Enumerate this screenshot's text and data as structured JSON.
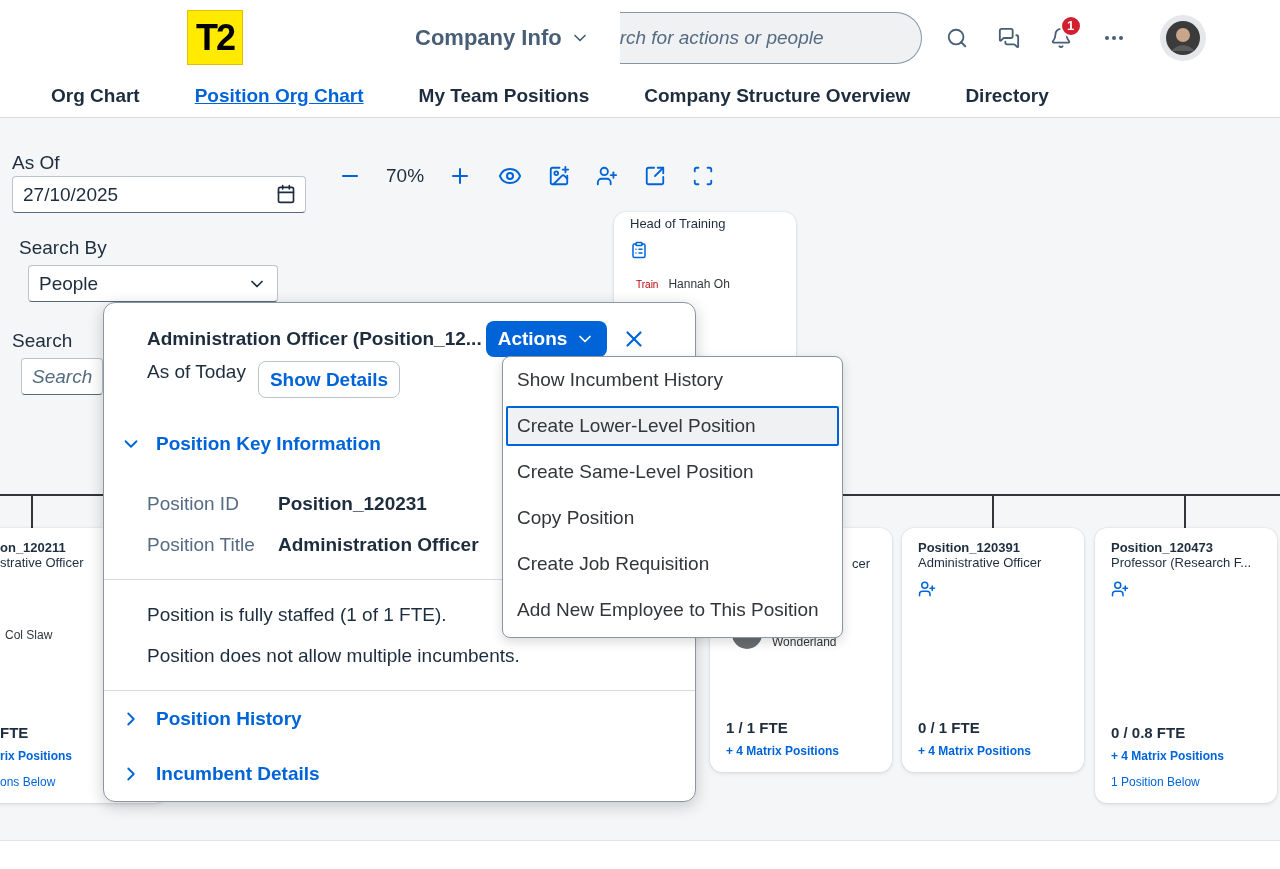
{
  "header": {
    "logo": "T2",
    "app_menu": {
      "label": "Company Info",
      "expanded": false
    },
    "search": {
      "placeholder": "rch for actions or people"
    },
    "notifications": {
      "count": "1"
    }
  },
  "nav_tabs": [
    {
      "label": "Org Chart",
      "selected": false
    },
    {
      "label": "Position Org Chart",
      "selected": true
    },
    {
      "label": "My Team Positions",
      "selected": false
    },
    {
      "label": "Company Structure Overview",
      "selected": false
    },
    {
      "label": "Directory",
      "selected": false
    }
  ],
  "filters": {
    "as_of": {
      "label": "As Of",
      "value": "27/10/2025"
    },
    "search_by": {
      "label": "Search By",
      "value": "People"
    },
    "search": {
      "label": "Search",
      "placeholder": "Search"
    }
  },
  "zoom": {
    "reading": "70%"
  },
  "chart_nodes": [
    {
      "kind": "requisition",
      "title": "Head of Training",
      "tag": "Train",
      "incumbent": "Hannah Oh"
    },
    {
      "kind": "partial",
      "id": "on_120211",
      "title": "strative Officer",
      "incumbent": "Col Slaw",
      "fte": "FTE",
      "matrix": "rix Positions",
      "below": "ons Below"
    },
    {
      "kind": "filled",
      "title": "cer",
      "incumbent": "Wonderland",
      "fte": "1 / 1 FTE",
      "matrix": "+ 4 Matrix Positions"
    },
    {
      "kind": "vacant",
      "id": "Position_120391",
      "title": "Administrative Officer",
      "fte": "0 / 1 FTE",
      "matrix": "+ 4 Matrix Positions"
    },
    {
      "kind": "vacant",
      "id": "Position_120473",
      "title": "Professor (Research F...",
      "fte": "0 / 0.8 FTE",
      "matrix": "+ 4 Matrix Positions",
      "below": "1 Position Below"
    }
  ],
  "position_popover": {
    "title": "Administration Officer (Position_12...",
    "actions": {
      "label": "Actions",
      "expanded": true
    },
    "as_of": "As of Today",
    "show_details": "Show Details",
    "sections": [
      {
        "title": "Position Key Information",
        "expanded": true,
        "fields": [
          {
            "label": "Position ID",
            "value": "Position_120231"
          },
          {
            "label": "Position Title",
            "value": "Administration Officer"
          }
        ],
        "notes": [
          "Position is fully staffed (1 of 1 FTE).",
          "Position does not allow multiple incumbents."
        ]
      },
      {
        "title": "Position History",
        "expanded": false
      },
      {
        "title": "Incumbent Details",
        "expanded": false
      }
    ]
  },
  "actions_menu": {
    "items": [
      {
        "label": "Show Incumbent History",
        "selected": false
      },
      {
        "label": "Create Lower-Level Position",
        "selected": true
      },
      {
        "label": "Create Same-Level Position",
        "selected": false
      },
      {
        "label": "Copy Position",
        "selected": false
      },
      {
        "label": "Create Job Requisition",
        "selected": false
      },
      {
        "label": "Add New Employee to This Position",
        "selected": false
      }
    ]
  }
}
